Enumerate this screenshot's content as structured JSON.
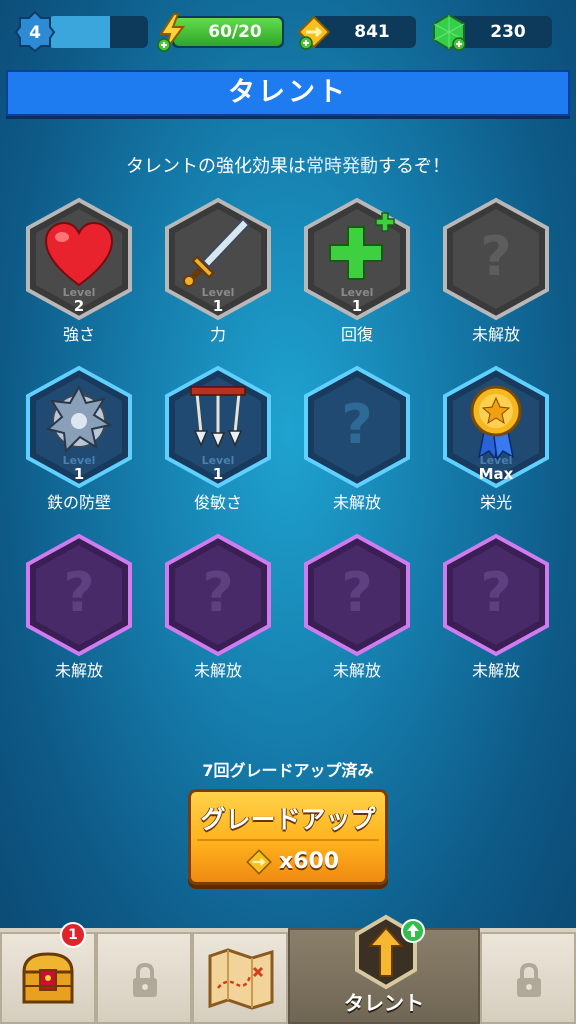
{
  "status": {
    "player_level": "4",
    "xp_fraction": 0.62,
    "energy": "60/20",
    "gold": "841",
    "gems": "230"
  },
  "header": {
    "title": "タレント"
  },
  "subtitle": {
    "before": "タレントの強化効果は",
    "highlight": "常時発動",
    "after": "するぞ！"
  },
  "talents": [
    {
      "name": "強さ",
      "level_label": "Level",
      "level": "2",
      "icon": "heart-icon",
      "frame": "gray"
    },
    {
      "name": "力",
      "level_label": "Level",
      "level": "1",
      "icon": "sword-icon",
      "frame": "gray"
    },
    {
      "name": "回復",
      "level_label": "Level",
      "level": "1",
      "icon": "green-plus-icon",
      "frame": "gray"
    },
    {
      "name": "未解放",
      "icon": "question-mark-icon",
      "frame": "gray-locked"
    },
    {
      "name": "鉄の防壁",
      "level_label": "Level",
      "level": "1",
      "icon": "spiked-shield-icon",
      "frame": "blue"
    },
    {
      "name": "俊敏さ",
      "level_label": "Level",
      "level": "1",
      "icon": "arrows-icon",
      "frame": "blue"
    },
    {
      "name": "未解放",
      "icon": "question-mark-icon",
      "frame": "blue-locked"
    },
    {
      "name": "栄光",
      "level_label": "Level",
      "level": "Max",
      "icon": "gold-medal-icon",
      "frame": "blue"
    },
    {
      "name": "未解放",
      "icon": "question-mark-icon",
      "frame": "purple-locked"
    },
    {
      "name": "未解放",
      "icon": "question-mark-icon",
      "frame": "purple-locked"
    },
    {
      "name": "未解放",
      "icon": "question-mark-icon",
      "frame": "purple-locked"
    },
    {
      "name": "未解放",
      "icon": "question-mark-icon",
      "frame": "purple-locked"
    }
  ],
  "upgrade": {
    "count_text": "7回グレードアップ済み",
    "button_label": "グレードアップ",
    "cost": "x600"
  },
  "nav": {
    "chest_badge": "1",
    "items": [
      {
        "icon": "treasure-chest-icon"
      },
      {
        "icon": "lock-icon"
      },
      {
        "icon": "treasure-map-icon"
      },
      {
        "icon": "talent-arrow-icon",
        "label": "タレント",
        "active": true
      },
      {
        "icon": "lock-icon"
      }
    ]
  },
  "colors": {
    "header_blue": "#1e7bf0",
    "energy_green": "#3fbf35",
    "gem_green": "#35d04a",
    "gold": "#f5b820",
    "frame_gray": "#a8a8a8",
    "frame_blue": "#4fc3f7",
    "frame_purple": "#c56fe8"
  }
}
